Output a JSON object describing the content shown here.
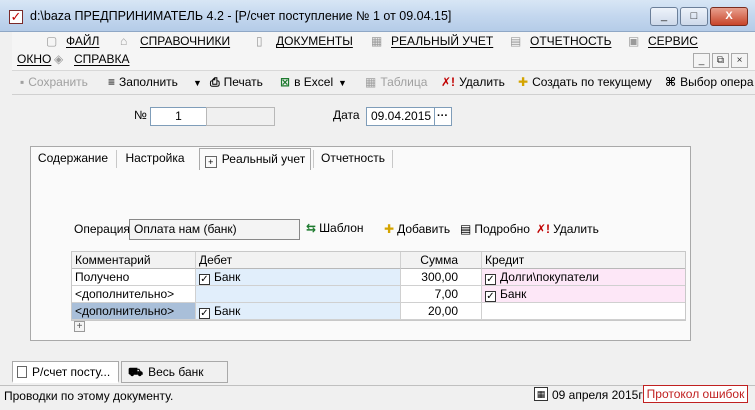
{
  "window": {
    "title": "d:\\baza  ПРЕДПРИНИМАТЕЛЬ 4.2 - [Р/счет поступление № 1 от 09.04.15]",
    "minimize": "_",
    "maximize": "□",
    "close": "X"
  },
  "menu": {
    "items": [
      {
        "label": "ФАЙЛ",
        "icon": "file-icon"
      },
      {
        "label": "СПРАВОЧНИКИ",
        "icon": "book-icon"
      },
      {
        "label": "ДОКУМЕНТЫ",
        "icon": "document-icon"
      },
      {
        "label": "РЕАЛЬНЫЙ УЧЕТ",
        "icon": "ledger-icon"
      },
      {
        "label": "ОТЧЕТНОСТЬ",
        "icon": "report-icon"
      },
      {
        "label": "СЕРВИС",
        "icon": "service-icon"
      }
    ],
    "row2": [
      {
        "label": "ОКНО",
        "icon": "window-icon"
      },
      {
        "label": "СПРАВКА",
        "icon": "help-icon"
      }
    ],
    "mdi": {
      "minimize": "_",
      "restore": "⧉",
      "close": "×"
    }
  },
  "toolbar": {
    "save": "Сохранить",
    "fill": "Заполнить",
    "print": "Печать",
    "excel": "в Excel",
    "table": "Таблица",
    "delete": "Удалить",
    "create_from": "Создать по текущему",
    "choose_op": "Выбор опера"
  },
  "header": {
    "number_label": "№",
    "number_value": "1",
    "date_label": "Дата",
    "date_value": "09.04.2015",
    "date_button": "···"
  },
  "tabs": [
    {
      "label": "Содержание"
    },
    {
      "label": "Настройка"
    },
    {
      "label": "Реальный учет",
      "active": true
    },
    {
      "label": "Отчетность"
    }
  ],
  "operation": {
    "label": "Операция",
    "value": "Оплата нам (банк)",
    "template": "Шаблон",
    "add": "Добавить",
    "details": "Подробно",
    "delete": "Удалить"
  },
  "grid": {
    "columns": [
      "Комментарий",
      "Дебет",
      "Сумма",
      "Кредит"
    ],
    "rows": [
      {
        "comment": "Получено",
        "debet": "Банк",
        "debet_checked": true,
        "sum": "300,00",
        "credit": "Долги\\покупатели",
        "credit_checked": true
      },
      {
        "comment": "<дополнительно>",
        "debet": "",
        "debet_checked": false,
        "sum": "7,00",
        "credit": "Банк",
        "credit_checked": true
      },
      {
        "comment": "<дополнительно>",
        "debet": "Банк",
        "debet_checked": true,
        "sum": "20,00",
        "credit": "",
        "credit_checked": false
      }
    ],
    "add_row": "+"
  },
  "bottom_tabs": [
    {
      "label": "Р/счет посту...",
      "active": true
    },
    {
      "label": "Весь банк",
      "active": false
    }
  ],
  "status": {
    "text": "Проводки по этому документу.",
    "date": "09 апреля 2015г",
    "errors": "Протокол ошибок"
  },
  "colors": {
    "debit_bg": "#e1eefb",
    "credit_bg": "#fde7f7",
    "selected_cell": "#a9bfd9",
    "error_red": "#c02020"
  }
}
